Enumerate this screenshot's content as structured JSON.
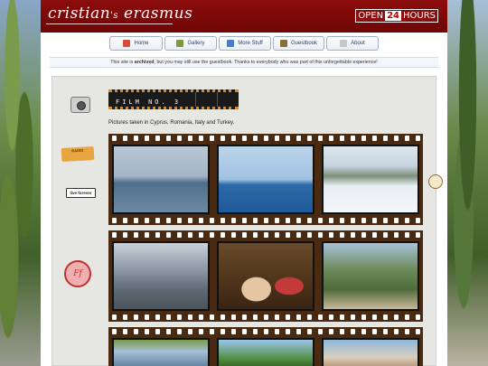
{
  "header": {
    "logo_main": "cristian",
    "logo_sep": "'s",
    "logo_last": " erasmus",
    "badge_open": "OPEN",
    "badge_num": "24",
    "badge_hours": "HOURS"
  },
  "nav": {
    "items": [
      {
        "label": "Home",
        "icon": "home-icon",
        "color": "#d94c3a"
      },
      {
        "label": "Gallery",
        "icon": "gallery-icon",
        "color": "#7b9b3a"
      },
      {
        "label": "More Stuff",
        "icon": "stuff-icon",
        "color": "#4a7acb"
      },
      {
        "label": "Guestbook",
        "icon": "book-icon",
        "color": "#8a6d3b"
      },
      {
        "label": "About",
        "icon": "about-icon",
        "color": "#c7c7c7"
      }
    ]
  },
  "notice": {
    "before": "This site is ",
    "bold": "archived",
    "after": ", but you may still use the guestbook. Thanks to everybody who was part of this unforgettable experience!"
  },
  "main": {
    "film_title": "FILM NO. 3",
    "caption": "Pictures taken in Cyprus, Romania, Italy and Turkey."
  },
  "sidebar_stickers": {
    "radio_label": "RADIO",
    "live_label": "live forever",
    "ff_label": "Ff"
  },
  "colors": {
    "header_red": "#8c0c0c",
    "film_brown": "#4a2a10",
    "nav_text": "#2a3a6a"
  },
  "photos": {
    "strip1": [
      "sea-horizon",
      "coastline-blue",
      "snowy-slope"
    ],
    "strip2": [
      "city-harbour",
      "dinner-table",
      "hillside-town"
    ],
    "strip3": [
      "tree-coast",
      "palm-beach",
      "coast-town"
    ]
  }
}
